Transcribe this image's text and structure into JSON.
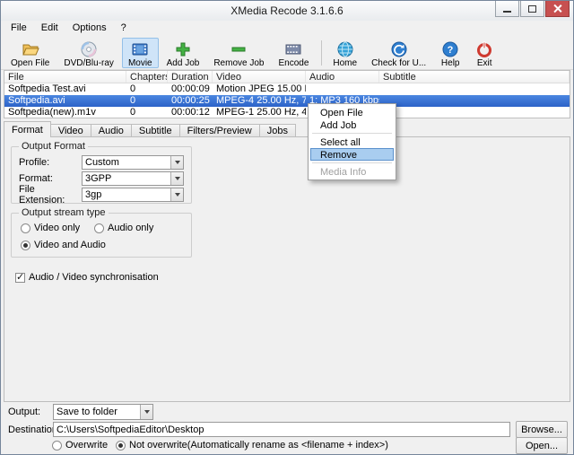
{
  "window": {
    "title": "XMedia Recode 3.1.6.6"
  },
  "menubar": {
    "items": [
      "File",
      "Edit",
      "Options",
      "?"
    ]
  },
  "toolbar": {
    "buttons": [
      {
        "label": "Open File",
        "icon": "folder-open"
      },
      {
        "label": "DVD/Blu-ray",
        "icon": "disc"
      },
      {
        "label": "Movie",
        "icon": "film",
        "active": true
      },
      {
        "label": "Add Job",
        "icon": "plus"
      },
      {
        "label": "Remove Job",
        "icon": "minus"
      },
      {
        "label": "Encode",
        "icon": "filmstrip"
      },
      {
        "label": "Home",
        "icon": "globe"
      },
      {
        "label": "Check for U...",
        "icon": "update"
      },
      {
        "label": "Help",
        "icon": "question"
      },
      {
        "label": "Exit",
        "icon": "power"
      }
    ]
  },
  "filelist": {
    "columns": [
      "File",
      "Chapters",
      "Duration",
      "Video",
      "Audio",
      "Subtitle"
    ],
    "rows": [
      {
        "file": "Softpedia Test.avi",
        "chapters": "0",
        "duration": "00:00:09",
        "video": "Motion JPEG 15.00 Hz, 32...",
        "audio": "",
        "subtitle": "",
        "selected": false
      },
      {
        "file": "Softpedia.avi",
        "chapters": "0",
        "duration": "00:00:25",
        "video": "MPEG-4 25.00 Hz, 704 x 3...",
        "audio": "1: MP3 160 kbps 44100 Hz...",
        "subtitle": "",
        "selected": true
      },
      {
        "file": "Softpedia(new).m1v",
        "chapters": "0",
        "duration": "00:00:12",
        "video": "MPEG-1 25.00 Hz, 480 x 5...",
        "audio": "",
        "subtitle": "",
        "selected": false
      }
    ]
  },
  "context_menu": {
    "items": [
      {
        "label": "Open File"
      },
      {
        "label": "Add Job"
      },
      {
        "separator": true
      },
      {
        "label": "Select all"
      },
      {
        "label": "Remove",
        "highlighted": true
      },
      {
        "separator": true
      },
      {
        "label": "Media Info",
        "disabled": true
      }
    ]
  },
  "tabs": {
    "items": [
      "Format",
      "Video",
      "Audio",
      "Subtitle",
      "Filters/Preview",
      "Jobs"
    ],
    "active": "Format"
  },
  "format_tab": {
    "output_format": {
      "title": "Output Format",
      "profile_label": "Profile:",
      "profile_value": "Custom",
      "format_label": "Format:",
      "format_value": "3GPP",
      "extension_label": "File Extension:",
      "extension_value": "3gp"
    },
    "stream_type": {
      "title": "Output stream type",
      "video_only": "Video only",
      "audio_only": "Audio only",
      "video_and_audio": "Video and Audio",
      "selected": "Video and Audio"
    },
    "sync_checkbox": {
      "label": "Audio / Video synchronisation",
      "checked": true
    }
  },
  "bottom": {
    "output_label": "Output:",
    "output_value": "Save to folder",
    "destination_label": "Destination:",
    "destination_value": "C:\\Users\\SoftpediaEditor\\Desktop",
    "browse_button": "Browse...",
    "open_button": "Open...",
    "overwrite_label": "Overwrite",
    "not_overwrite_label": "Not overwrite(Automatically rename as <filename + index>)",
    "selected": "not_overwrite"
  }
}
